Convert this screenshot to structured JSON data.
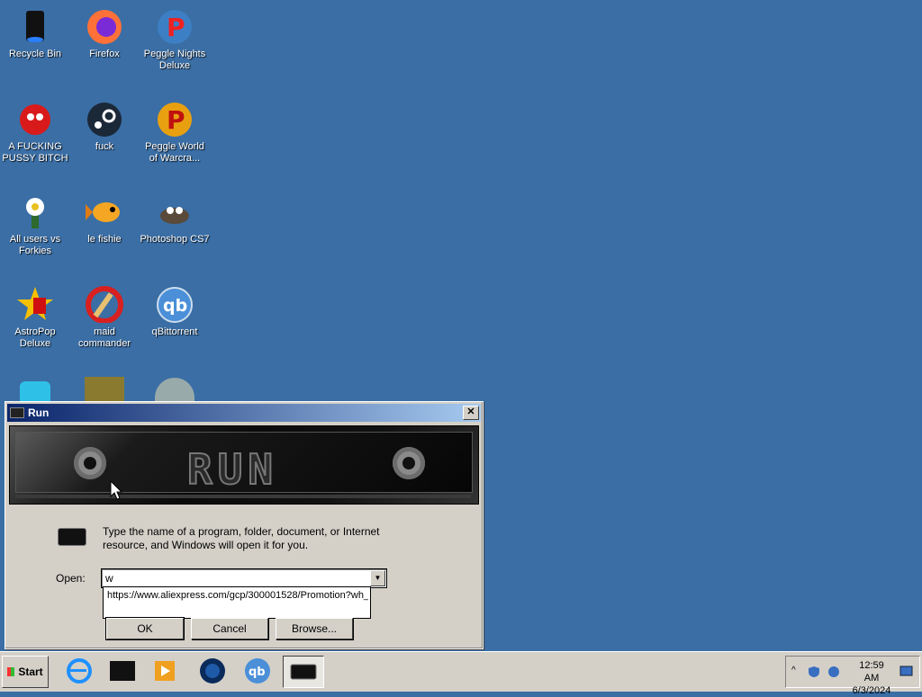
{
  "desktop": {
    "icons": [
      {
        "label": "Recycle Bin",
        "icon": "recycle-bin-icon"
      },
      {
        "label": "Firefox",
        "icon": "firefox-icon"
      },
      {
        "label": "Peggle Nights Deluxe",
        "icon": "peggle-icon"
      },
      {
        "label": "A FUCKING PUSSY BITCH",
        "icon": "red-creature-icon"
      },
      {
        "label": "fuck",
        "icon": "steam-icon"
      },
      {
        "label": "Peggle World of Warcra...",
        "icon": "peggle-icon"
      },
      {
        "label": "All users vs Forkies",
        "icon": "flower-icon"
      },
      {
        "label": "le fishie",
        "icon": "fish-icon"
      },
      {
        "label": "Photoshop CS7",
        "icon": "gimp-icon"
      },
      {
        "label": "AstroPop Deluxe",
        "icon": "astropop-icon"
      },
      {
        "label": "maid commander",
        "icon": "ccleaner-icon"
      },
      {
        "label": "qBittorrent",
        "icon": "qbittorrent-icon"
      }
    ]
  },
  "run_dialog": {
    "title": "Run",
    "close": "✕",
    "banner_text": "RUN",
    "description": "Type the name of a program, folder, document, or Internet resource, and Windows will open it for you.",
    "open_label": "Open:",
    "open_value": "w",
    "suggestion": "https://www.aliexpress.com/gcp/300001528/Promotion?wh_",
    "ok_label": "OK",
    "cancel_label": "Cancel",
    "browse_label": "Browse..."
  },
  "taskbar": {
    "start_label": "Start",
    "time": "12:59 AM",
    "date": "6/3/2024"
  },
  "colors": {
    "desktop": "#3a6ea5",
    "titlebar_start": "#0a246a",
    "titlebar_end": "#a6caf0",
    "chrome": "#d4d0c8"
  }
}
